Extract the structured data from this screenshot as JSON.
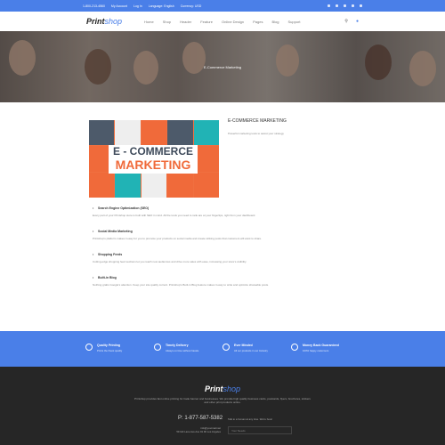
{
  "topbar": {
    "phone": "1-800-213-4560",
    "account": "My Account",
    "login": "Log In",
    "language": "Language: English",
    "currency": "Currency: USD"
  },
  "header": {
    "logo_main": "Print",
    "logo_accent": "shop",
    "nav": [
      "Home",
      "Shop",
      "Header",
      "Feature",
      "Online Design",
      "Pages",
      "Blog",
      "Support"
    ]
  },
  "hero": {
    "breadcrumb": "E-Commerce Marketing"
  },
  "content": {
    "image_line1": "E - COMMERCE",
    "image_line2": "MARKETING",
    "title": "E-COMMERCE MARKETING",
    "subtitle": "Powerful marketing tools to assist your strategy",
    "items": [
      {
        "title": "Search Engine Optimization (SEO)",
        "text": "Every part of your Printshop store is built with SEO in mind. All the tools you need to rank are at your fingertips, right from your dashboard."
      },
      {
        "title": "Social Media Marketing",
        "text": "Printshop's platform makes it easy for you to promote your products on social media and create striking posts that customers will want to share."
      },
      {
        "title": "Shopping Feeds",
        "text": "Cutting-edge shopping feed sections let you reach new audiences and drive more sales with ease, increasing your store's visibility."
      },
      {
        "title": "Built-in Blog",
        "text": "Nothing grabs Google's attention. Keep your site quality current. Printshop's Built-in Blog feature makes it easy to write and optimize shareable posts."
      }
    ]
  },
  "features": [
    {
      "title": "Quality Printing",
      "text": "Prints the finest quality"
    },
    {
      "title": "Timely Delivery",
      "text": "Always on time without hassle"
    },
    {
      "title": "Ever Minded",
      "text": "All our products in our Industry"
    },
    {
      "title": "Money Back Guaranteed",
      "text": "100% happy customers"
    }
  ],
  "footer": {
    "logo_main": "Print",
    "logo_accent": "shop",
    "description": "Printshop provides fast online printing for trade banner and businesses. We provide high quality business cards, postcards, flyers, brochures, stickers and other print products online.",
    "phone": "P: 1-877-587-5382",
    "note": "Talk to a human at any time. We're here!",
    "email": "info@yourmail.net",
    "address": "59 Gilt Lane Ave Ave 91 90 Los Angeles",
    "select_placeholder": "Your Needs"
  }
}
